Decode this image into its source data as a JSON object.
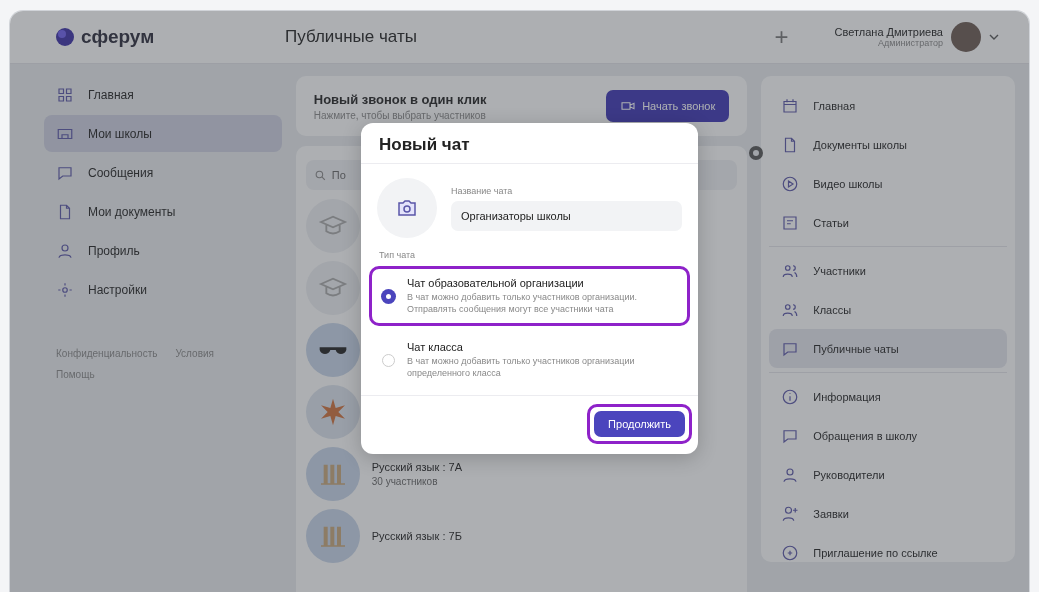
{
  "header": {
    "logo": "сферум",
    "title": "Публичные чаты",
    "add": "+",
    "user_name": "Светлана Дмитриева",
    "user_role": "Администратор"
  },
  "sidebar": {
    "items": [
      {
        "label": "Главная",
        "selected": false
      },
      {
        "label": "Мои школы",
        "selected": true
      },
      {
        "label": "Сообщения",
        "selected": false
      },
      {
        "label": "Мои документы",
        "selected": false
      },
      {
        "label": "Профиль",
        "selected": false
      },
      {
        "label": "Настройки",
        "selected": false
      }
    ],
    "footer_links": [
      "Конфиденциальность",
      "Условия",
      "Помощь"
    ]
  },
  "call_card": {
    "title": "Новый звонок в один клик",
    "subtitle": "Нажмите, чтобы выбрать участников",
    "button": "Начать звонок"
  },
  "search": {
    "placeholder": "По"
  },
  "chats": [
    {
      "kind": "cap"
    },
    {
      "kind": "cap"
    },
    {
      "kind": "glasses"
    },
    {
      "kind": "star"
    },
    {
      "kind": "books",
      "name": "Русский язык : 7А",
      "members": "30 участников"
    },
    {
      "kind": "books",
      "name": "Русский язык : 7Б"
    }
  ],
  "right_menu": {
    "groups": [
      [
        {
          "label": "Главная",
          "selected": false
        },
        {
          "label": "Документы школы",
          "selected": false
        },
        {
          "label": "Видео школы",
          "selected": false
        },
        {
          "label": "Статьи",
          "selected": false
        }
      ],
      [
        {
          "label": "Участники",
          "selected": false
        },
        {
          "label": "Классы",
          "selected": false
        },
        {
          "label": "Публичные чаты",
          "selected": true
        }
      ],
      [
        {
          "label": "Информация",
          "selected": false
        },
        {
          "label": "Обращения в школу",
          "selected": false
        },
        {
          "label": "Руководители",
          "selected": false
        },
        {
          "label": "Заявки",
          "selected": false
        },
        {
          "label": "Приглашение по ссылке",
          "selected": false
        }
      ]
    ]
  },
  "dialog": {
    "title": "Новый чат",
    "name_label": "Название чата",
    "name_value": "Организаторы школы",
    "type_label": "Тип чата",
    "options": [
      {
        "title": "Чат образовательной организации",
        "description": "В чат можно добавить только участников организации. Отправлять сообщения могут все участники чата",
        "selected": true,
        "highlighted": true
      },
      {
        "title": "Чат класса",
        "description": "В чат можно добавить только участников организации определенного класса",
        "selected": false,
        "highlighted": false
      }
    ],
    "button": "Продолжить",
    "button_highlighted": true
  }
}
